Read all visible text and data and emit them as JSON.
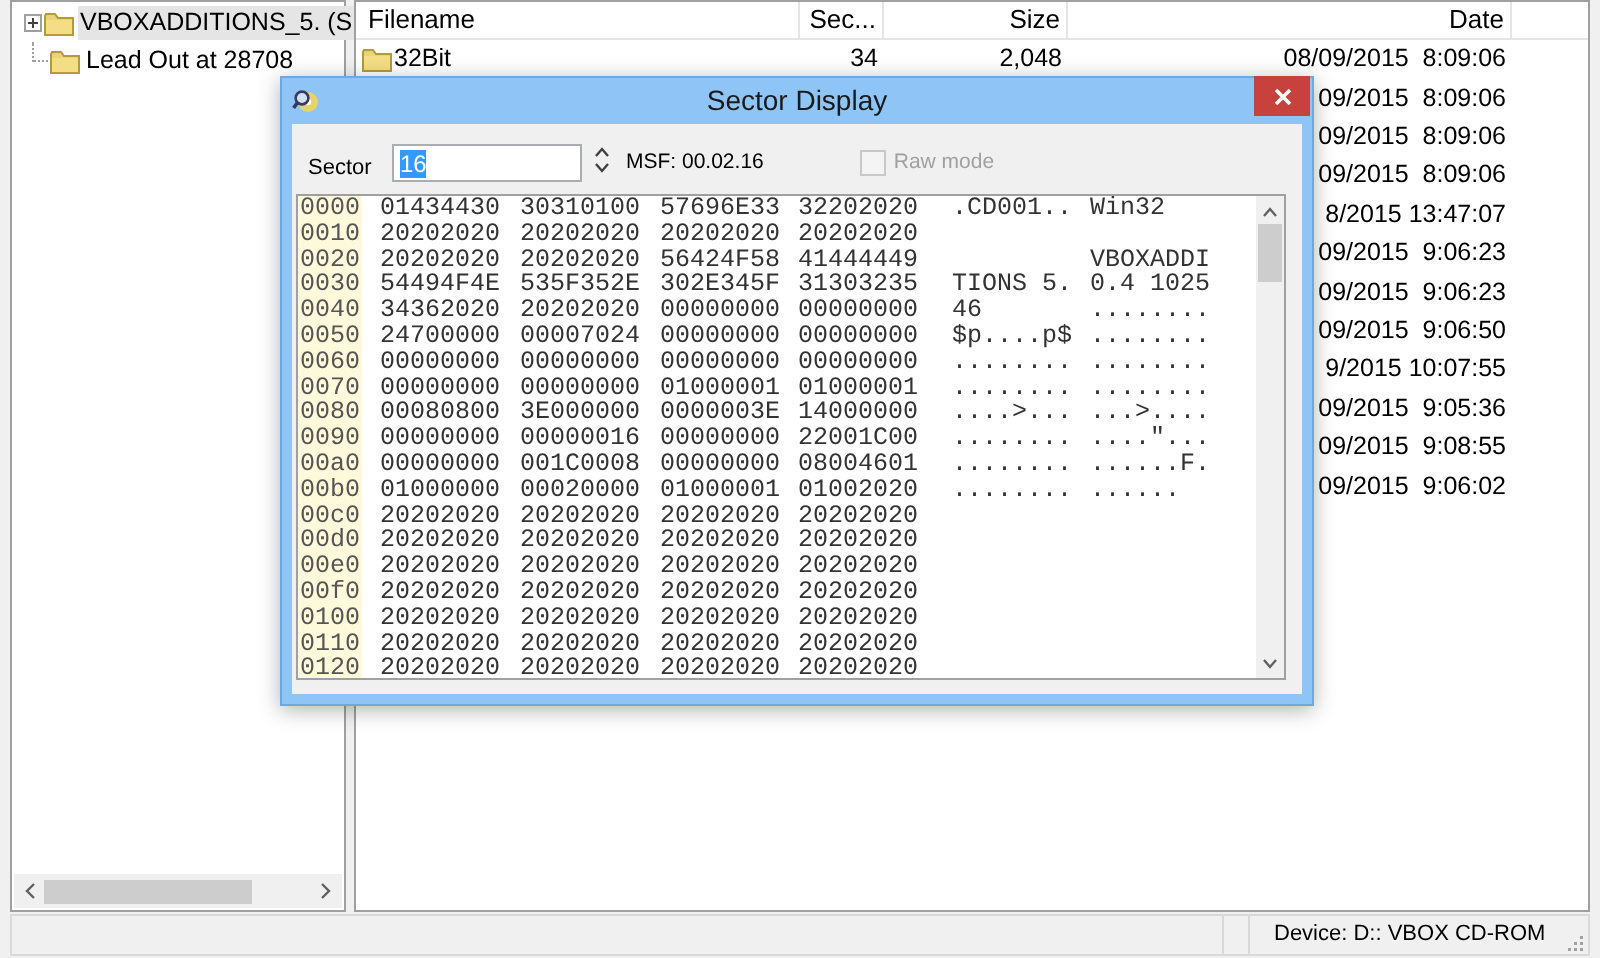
{
  "tree": [
    {
      "label": "VBOXADDITIONS_5. (S",
      "selected": true,
      "expanded": false,
      "has_children": true
    },
    {
      "label": "Lead Out at 28708",
      "selected": false,
      "has_children": false
    }
  ],
  "file_list": {
    "columns": [
      "Filename",
      "Sec...",
      "Size",
      "Date"
    ],
    "rows": [
      {
        "filename": "32Bit",
        "column_2": "34",
        "size": "2,048",
        "date": "08/09/2015  8:09:06"
      },
      {
        "date": "09/2015  8:09:06"
      },
      {
        "date": "09/2015  8:09:06"
      },
      {
        "date": "09/2015  8:09:06"
      },
      {
        "date": "8/2015 13:47:07"
      },
      {
        "date": "09/2015  9:06:23"
      },
      {
        "date": "09/2015  9:06:23"
      },
      {
        "date": "09/2015  9:06:50"
      },
      {
        "date": "9/2015 10:07:55"
      },
      {
        "date": "09/2015  9:05:36"
      },
      {
        "date": "09/2015  9:08:55"
      },
      {
        "date": "09/2015  9:06:02"
      }
    ]
  },
  "status_bar": {
    "device": "Device: D:: VBOX CD-ROM"
  },
  "dialog": {
    "title": "Sector Display",
    "sector_label": "Sector",
    "sector_value": "16",
    "msf": "MSF: 00.02.16",
    "raw_mode": {
      "label": "Raw mode",
      "checked": false,
      "disabled": true
    },
    "hex_rows": [
      {
        "address": "0000",
        "bytes": [
          "01434430",
          "30310100",
          "57696E33",
          "32202020"
        ],
        "ascii_1": ".CD001..",
        "ascii_2": "Win32"
      },
      {
        "address": "0010",
        "bytes": [
          "20202020",
          "20202020",
          "20202020",
          "20202020"
        ]
      },
      {
        "address": "0020",
        "bytes": [
          "20202020",
          "20202020",
          "56424F58",
          "41444449"
        ],
        "ascii_2": "VBOXADDI"
      },
      {
        "address": "0030",
        "bytes": [
          "54494F4E",
          "535F352E",
          "302E345F",
          "31303235"
        ],
        "ascii_1": "TIONS 5.",
        "ascii_2": "0.4 1025"
      },
      {
        "address": "0040",
        "bytes": [
          "34362020",
          "20202020",
          "00000000",
          "00000000"
        ],
        "ascii_1": "46",
        "ascii_2": "........"
      },
      {
        "address": "0050",
        "bytes": [
          "24700000",
          "00007024",
          "00000000",
          "00000000"
        ],
        "ascii_1": "$p....p$",
        "ascii_2": "........"
      },
      {
        "address": "0060",
        "bytes": [
          "00000000",
          "00000000",
          "00000000",
          "00000000"
        ],
        "ascii_1": "........",
        "ascii_2": "........"
      },
      {
        "address": "0070",
        "bytes": [
          "00000000",
          "00000000",
          "01000001",
          "01000001"
        ],
        "ascii_1": "........",
        "ascii_2": "........"
      },
      {
        "address": "0080",
        "bytes": [
          "00080800",
          "3E000000",
          "0000003E",
          "14000000"
        ],
        "ascii_1": "....>...",
        "ascii_2": "...>...."
      },
      {
        "address": "0090",
        "bytes": [
          "00000000",
          "00000016",
          "00000000",
          "22001C00"
        ],
        "ascii_1": "........",
        "ascii_2": "....\"..."
      },
      {
        "address": "00a0",
        "bytes": [
          "00000000",
          "001C0008",
          "00000000",
          "08004601"
        ],
        "ascii_1": "........",
        "ascii_2": "......F."
      },
      {
        "address": "00b0",
        "bytes": [
          "01000000",
          "00020000",
          "01000001",
          "01002020"
        ],
        "ascii_1": "........",
        "ascii_2": "......"
      },
      {
        "address": "00c0",
        "bytes": [
          "20202020",
          "20202020",
          "20202020",
          "20202020"
        ]
      },
      {
        "address": "00d0",
        "bytes": [
          "20202020",
          "20202020",
          "20202020",
          "20202020"
        ]
      },
      {
        "address": "00e0",
        "bytes": [
          "20202020",
          "20202020",
          "20202020",
          "20202020"
        ]
      },
      {
        "address": "00f0",
        "bytes": [
          "20202020",
          "20202020",
          "20202020",
          "20202020"
        ]
      },
      {
        "address": "0100",
        "bytes": [
          "20202020",
          "20202020",
          "20202020",
          "20202020"
        ]
      },
      {
        "address": "0110",
        "bytes": [
          "20202020",
          "20202020",
          "20202020",
          "20202020"
        ]
      },
      {
        "address": "0120",
        "bytes": [
          "20202020",
          "20202020",
          "20202020",
          "20202020"
        ]
      }
    ]
  }
}
